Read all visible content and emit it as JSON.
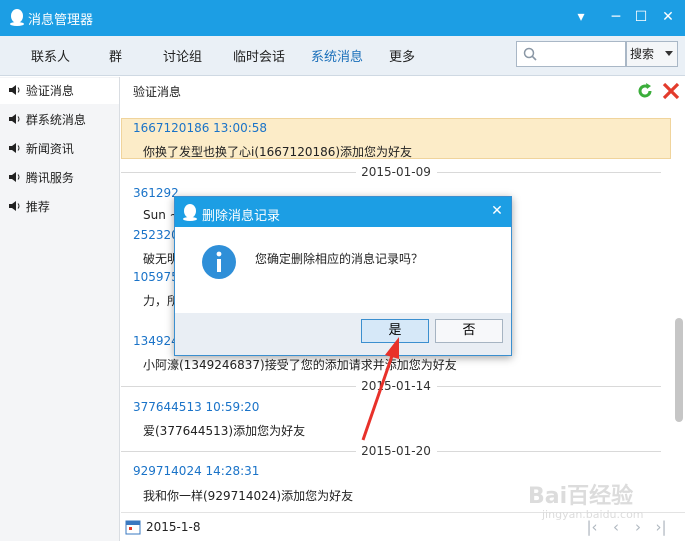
{
  "window": {
    "title": "消息管理器"
  },
  "colors": {
    "accent": "#1c9ee4",
    "highlight": "#fcecc8",
    "link": "#1a73c8",
    "arrow": "#e8312a"
  },
  "nav": {
    "tabs": [
      "联系人",
      "群",
      "讨论组",
      "临时会话",
      "系统消息",
      "更多"
    ],
    "active_tab": "系统消息",
    "search_placeholder": "",
    "search_button": "搜索"
  },
  "sidebar": {
    "items": [
      {
        "label": "验证消息",
        "icon": "speaker-icon"
      },
      {
        "label": "群系统消息",
        "icon": "speaker-icon"
      },
      {
        "label": "新闻资讯",
        "icon": "speaker-icon"
      },
      {
        "label": "腾讯服务",
        "icon": "speaker-icon"
      },
      {
        "label": "推荐",
        "icon": "speaker-icon"
      }
    ],
    "selected": "验证消息"
  },
  "content": {
    "header": "验证消息",
    "dates": [
      "2015-01-09",
      "2015-01-14",
      "2015-01-20"
    ],
    "messages": [
      {
        "head": "1667120186 13:00:58",
        "body": "你换了发型也换了心i(1667120186)添加您为好友"
      },
      {
        "head": "361292",
        "body": "Sun ~"
      },
      {
        "head": "252320",
        "body": "破无明"
      },
      {
        "head": "105975",
        "body": "力，所"
      },
      {
        "head": "134924",
        "body": "小阿濠(1349246837)接受了您的添加请求并添加您为好友"
      },
      {
        "head": "377644513 10:59:20",
        "body": "爱(377644513)添加您为好友"
      },
      {
        "head": "929714024 14:28:31",
        "body": "我和你一样(929714024)添加您为好友"
      }
    ]
  },
  "bottom": {
    "date": "2015-1-8"
  },
  "watermark": {
    "text": "Bai百经验",
    "sub": "jingyan.baidu.com"
  },
  "dialog": {
    "title": "删除消息记录",
    "message": "您确定删除相应的消息记录吗？",
    "yes": "是",
    "no": "否"
  }
}
